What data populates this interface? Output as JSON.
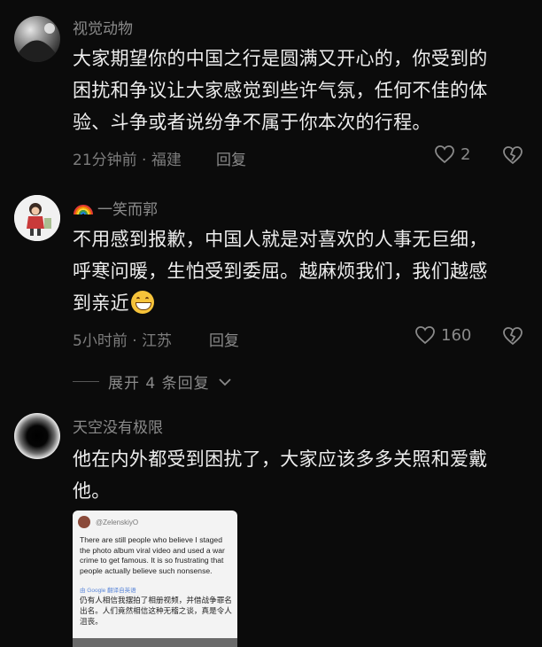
{
  "comments": [
    {
      "username": "视觉动物",
      "lines": [
        "大家期望你的中国之行是圆满又开心的，你受到的",
        "困扰和争议让大家感觉到些许气氛，任何不佳的体",
        "验、斗争或者说纷争不属于你本次的行程。"
      ],
      "meta": "21分钟前 · 福建",
      "reply_label": "回复",
      "likes": "2",
      "avatar_icon": "avatar-dark-ball-icon"
    },
    {
      "username": "一笑而郭",
      "username_prefix_icon": "rainbow-icon",
      "lines": [
        "不用感到报歉，中国人就是对喜欢的人事无巨细，",
        "呼寒问暖，生怕受到委屈。越麻烦我们，我们越感",
        "到亲近"
      ],
      "emoji": "grinning-face-icon",
      "meta": "5小时前 · 江苏",
      "reply_label": "回复",
      "likes": "160",
      "avatar_icon": "avatar-cartoon-girl-icon"
    },
    {
      "username": "天空没有极限",
      "lines": [
        "他在内外都受到困扰了，大家应该多多关照和爱戴",
        "他。"
      ],
      "avatar_icon": "avatar-black-hole-icon",
      "image": {
        "handle": "@ZelenskiyO",
        "english": "There are still people who believe I staged the photo album viral video and used a war crime to get famous. It is so frustrating that people actually believe such nonsense.",
        "google": "由 Google 翻译自英语",
        "chinese": "仍有人相信我摆拍了相册视频，并借战争罪名出名。人们竟然相信这种无稽之谈，真是令人沮丧。"
      }
    }
  ],
  "expand_replies": {
    "label": "展开 4 条回复"
  },
  "colors": {
    "background": "#0b0b0b",
    "text": "#ededed",
    "muted": "#8a8a8a"
  }
}
